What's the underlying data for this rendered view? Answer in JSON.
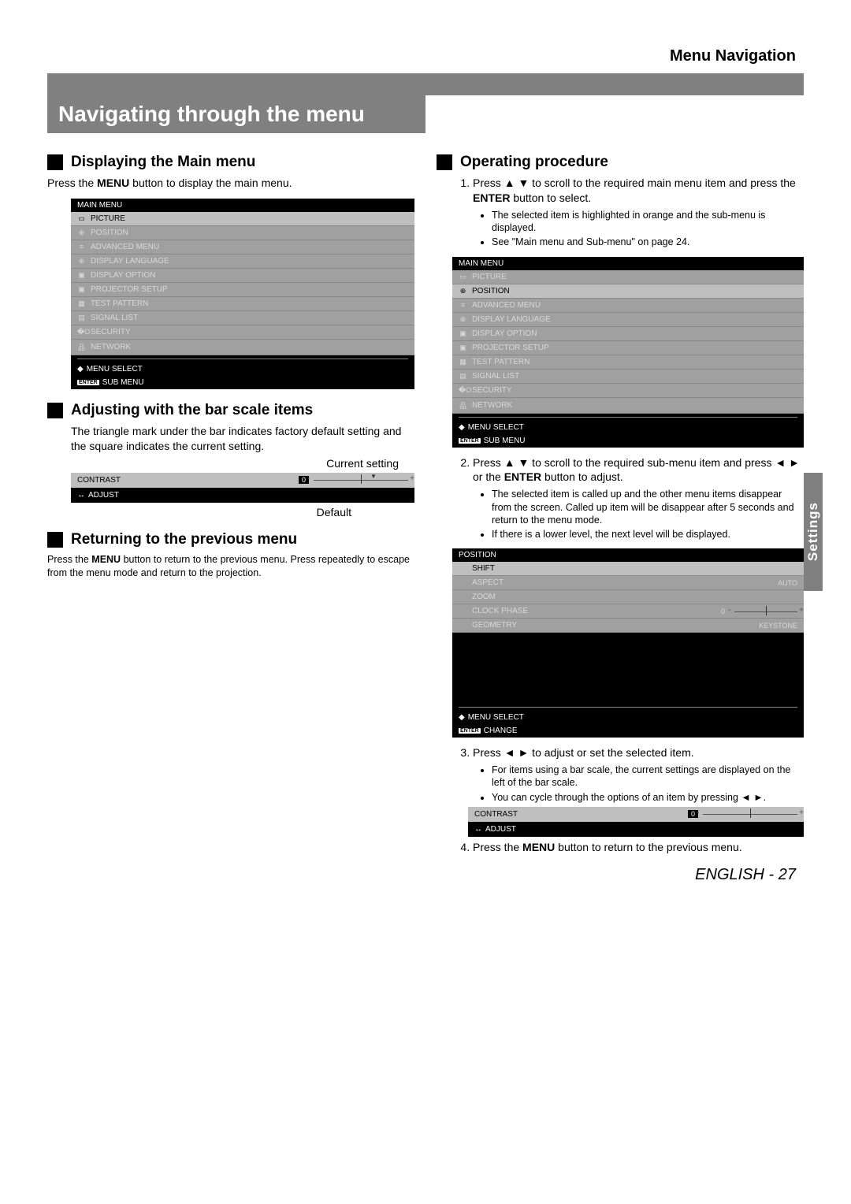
{
  "header": "Menu Navigation",
  "title": "Navigating through the menu",
  "sideTab": "Settings",
  "footer": {
    "lang": "ENGLISH",
    "sep": " - ",
    "page": "27"
  },
  "arrows": {
    "up": "▲",
    "down": "▼",
    "left": "◄",
    "right": "►",
    "updown": "◆",
    "leftright": "↔"
  },
  "enterBadge": "ENTER",
  "left": {
    "s1": {
      "title": "Displaying the Main menu",
      "text_a": "Press the ",
      "text_b": "MENU",
      "text_c": " button to display the main menu."
    },
    "s2": {
      "title": "Adjusting with the bar scale items",
      "text": "The triangle mark under the bar indicates factory default setting and the square indicates the current setting.",
      "captionTop": "Current setting",
      "captionBottom": "Default"
    },
    "s3": {
      "title": "Returning to the previous menu",
      "text_a": "Press the ",
      "text_b": "MENU",
      "text_c": " button to return to the previous menu. Press repeatedly to escape from the menu mode and return to the projection."
    }
  },
  "right": {
    "s1": {
      "title": "Operating procedure"
    },
    "step1_a": "Press ",
    "step1_b": " to scroll to the required main menu item and press the ",
    "step1_c": "ENTER",
    "step1_d": " button to select.",
    "step1_bullets": [
      "The selected item is highlighted in orange and the sub-menu is displayed.",
      "See \"Main menu and Sub-menu\" on page 24."
    ],
    "step2_a": "Press ",
    "step2_b": " to scroll to the required sub-menu item and press ",
    "step2_c": " or the ",
    "step2_d": "ENTER",
    "step2_e": " button to adjust.",
    "step2_bullets": [
      "The selected item is called up and the other menu items disappear from the screen. Called up item will be disappear after 5 seconds and return to the menu mode.",
      "If there is a lower level, the next level will be displayed."
    ],
    "step3_a": "Press ",
    "step3_b": " to adjust or set the selected item.",
    "step3_bullets_a": "For items using a bar scale, the current settings are displayed on the left of the bar scale.",
    "step3_bullets_b_a": "You can cycle through the options of an item by pressing ",
    "step3_bullets_b_b": ".",
    "step4_a": "Press the ",
    "step4_b": "MENU",
    "step4_c": " button to return to the previous menu."
  },
  "osdMain": {
    "title": "MAIN MENU",
    "selectedIndex": 0,
    "items": [
      {
        "icon": "▭",
        "label": "PICTURE"
      },
      {
        "icon": "⊕",
        "label": "POSITION"
      },
      {
        "icon": "≡",
        "label": "ADVANCED MENU"
      },
      {
        "icon": "⊕",
        "label": "DISPLAY LANGUAGE"
      },
      {
        "icon": "▣",
        "label": "DISPLAY OPTION"
      },
      {
        "icon": "▣",
        "label": "PROJECTOR SETUP"
      },
      {
        "icon": "▦",
        "label": "TEST PATTERN"
      },
      {
        "icon": "▤",
        "label": "SIGNAL LIST"
      },
      {
        "icon": "�O",
        "label": "SECURITY"
      },
      {
        "icon": "品",
        "label": "NETWORK"
      }
    ],
    "foot1": "MENU SELECT",
    "foot2": "SUB MENU"
  },
  "osdMain2": {
    "selectedIndex": 1
  },
  "osdPosition": {
    "title": "POSITION",
    "items": [
      {
        "label": "SHIFT",
        "sel": true
      },
      {
        "label": "ASPECT",
        "val": "AUTO"
      },
      {
        "label": "ZOOM"
      },
      {
        "label": "CLOCK PHASE",
        "val": "0",
        "bar": true
      },
      {
        "label": "GEOMETRY",
        "val": "KEYSTONE"
      }
    ],
    "foot1": "MENU SELECT",
    "foot2": "CHANGE"
  },
  "barContrast": {
    "label": "CONTRAST",
    "value": "0",
    "foot": "ADJUST"
  }
}
